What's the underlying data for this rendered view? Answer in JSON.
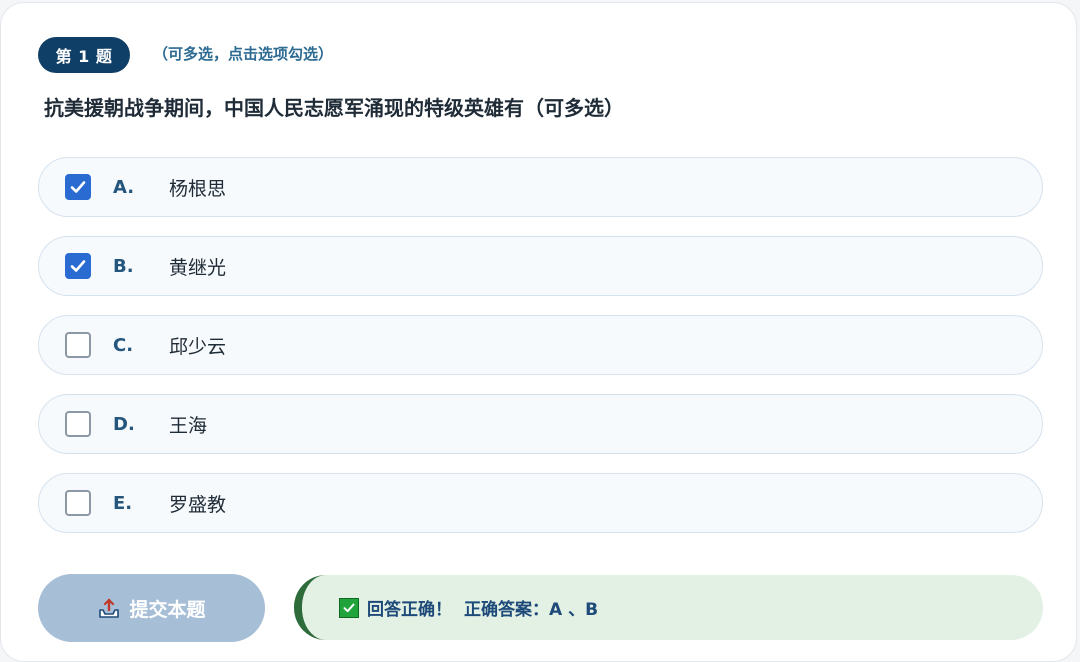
{
  "question": {
    "badge": "第 1 题",
    "hint": "（可多选，点击选项勾选）",
    "text": "抗美援朝战争期间，中国人民志愿军涌现的特级英雄有（可多选）"
  },
  "options": [
    {
      "letter": "A.",
      "text": "杨根思",
      "checked": true
    },
    {
      "letter": "B.",
      "text": "黄继光",
      "checked": true
    },
    {
      "letter": "C.",
      "text": "邱少云",
      "checked": false
    },
    {
      "letter": "D.",
      "text": "王海",
      "checked": false
    },
    {
      "letter": "E.",
      "text": "罗盛教",
      "checked": false
    }
  ],
  "submit": {
    "label": "提交本题"
  },
  "result": {
    "status": "回答正确！",
    "answer": "正确答案：A 、B"
  },
  "colors": {
    "badge": "#0f3f66",
    "checkbox_checked": "#2a6bd1",
    "submit_bg": "#a6bed6",
    "result_bg": "#e3f1e4",
    "result_border": "#2e6b3a"
  },
  "icons": {
    "submit": "upload-tray-icon",
    "result": "check-box-icon"
  }
}
